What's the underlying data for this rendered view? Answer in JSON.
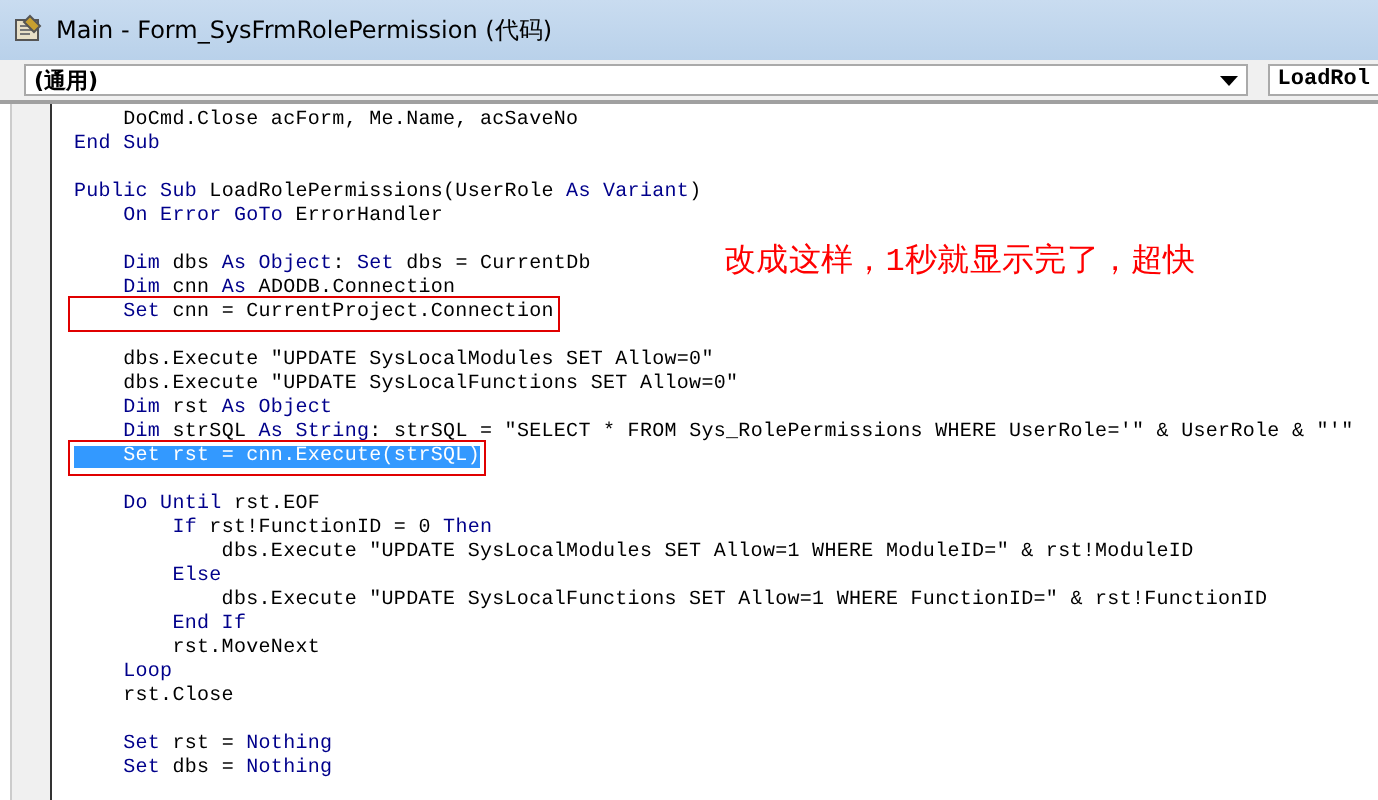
{
  "window": {
    "title": "Main - Form_SysFrmRolePermission (代码)"
  },
  "object_combo": {
    "value": "(通用)"
  },
  "procedure_combo": {
    "value": "LoadRol"
  },
  "code_lines": [
    {
      "kind": "code",
      "tokens": [
        {
          "text": "    DoCmd.Close acForm, Me.Name, acSaveNo",
          "kind": "plain"
        }
      ]
    },
    {
      "kind": "code",
      "tokens": [
        {
          "text": "End Sub",
          "kind": "keyword"
        }
      ]
    },
    {
      "kind": "blank"
    },
    {
      "kind": "code",
      "tokens": [
        {
          "text": "Public Sub",
          "kind": "keyword"
        },
        {
          "text": " LoadRolePermissions(UserRole ",
          "kind": "plain"
        },
        {
          "text": "As Variant",
          "kind": "keyword"
        },
        {
          "text": ")",
          "kind": "plain"
        }
      ]
    },
    {
      "kind": "code",
      "tokens": [
        {
          "text": "    On Error GoTo",
          "kind": "keyword"
        },
        {
          "text": " ErrorHandler",
          "kind": "plain"
        }
      ]
    },
    {
      "kind": "blank"
    },
    {
      "kind": "code",
      "tokens": [
        {
          "text": "    Dim",
          "kind": "keyword"
        },
        {
          "text": " dbs ",
          "kind": "plain"
        },
        {
          "text": "As Object",
          "kind": "keyword"
        },
        {
          "text": ": ",
          "kind": "plain"
        },
        {
          "text": "Set",
          "kind": "keyword"
        },
        {
          "text": " dbs = CurrentDb",
          "kind": "plain"
        }
      ]
    },
    {
      "kind": "code",
      "tokens": [
        {
          "text": "    Dim",
          "kind": "keyword"
        },
        {
          "text": " cnn ",
          "kind": "plain"
        },
        {
          "text": "As",
          "kind": "keyword"
        },
        {
          "text": " ADODB.Connection",
          "kind": "plain"
        }
      ]
    },
    {
      "kind": "code",
      "boxed": true,
      "selected": false,
      "tokens": [
        {
          "text": "    Set",
          "kind": "keyword"
        },
        {
          "text": " cnn = CurrentProject.Connection",
          "kind": "plain"
        }
      ]
    },
    {
      "kind": "blank"
    },
    {
      "kind": "code",
      "tokens": [
        {
          "text": "    dbs.Execute \"UPDATE SysLocalModules SET Allow=0\"",
          "kind": "plain"
        }
      ]
    },
    {
      "kind": "code",
      "tokens": [
        {
          "text": "    dbs.Execute \"UPDATE SysLocalFunctions SET Allow=0\"",
          "kind": "plain"
        }
      ]
    },
    {
      "kind": "code",
      "tokens": [
        {
          "text": "    Dim",
          "kind": "keyword"
        },
        {
          "text": " rst ",
          "kind": "plain"
        },
        {
          "text": "As Object",
          "kind": "keyword"
        }
      ]
    },
    {
      "kind": "code",
      "tokens": [
        {
          "text": "    Dim",
          "kind": "keyword"
        },
        {
          "text": " strSQL ",
          "kind": "plain"
        },
        {
          "text": "As String",
          "kind": "keyword"
        },
        {
          "text": ": strSQL = \"SELECT * FROM Sys_RolePermissions WHERE UserRole='\" & UserRole & \"'\"",
          "kind": "plain"
        }
      ]
    },
    {
      "kind": "code",
      "boxed": true,
      "selected": true,
      "tokens": [
        {
          "text": "    Set",
          "kind": "keyword"
        },
        {
          "text": " rst = cnn.Execute(strSQL)",
          "kind": "plain"
        }
      ]
    },
    {
      "kind": "blank"
    },
    {
      "kind": "code",
      "tokens": [
        {
          "text": "    Do Until",
          "kind": "keyword"
        },
        {
          "text": " rst.EOF",
          "kind": "plain"
        }
      ]
    },
    {
      "kind": "code",
      "tokens": [
        {
          "text": "        If",
          "kind": "keyword"
        },
        {
          "text": " rst!FunctionID = 0 ",
          "kind": "plain"
        },
        {
          "text": "Then",
          "kind": "keyword"
        }
      ]
    },
    {
      "kind": "code",
      "tokens": [
        {
          "text": "            dbs.Execute \"UPDATE SysLocalModules SET Allow=1 WHERE ModuleID=\" & rst!ModuleID",
          "kind": "plain"
        }
      ]
    },
    {
      "kind": "code",
      "tokens": [
        {
          "text": "        Else",
          "kind": "keyword"
        }
      ]
    },
    {
      "kind": "code",
      "tokens": [
        {
          "text": "            dbs.Execute \"UPDATE SysLocalFunctions SET Allow=1 WHERE FunctionID=\" & rst!FunctionID",
          "kind": "plain"
        }
      ]
    },
    {
      "kind": "code",
      "tokens": [
        {
          "text": "        End If",
          "kind": "keyword"
        }
      ]
    },
    {
      "kind": "code",
      "tokens": [
        {
          "text": "        rst.MoveNext",
          "kind": "plain"
        }
      ]
    },
    {
      "kind": "code",
      "tokens": [
        {
          "text": "    Loop",
          "kind": "keyword"
        }
      ]
    },
    {
      "kind": "code",
      "tokens": [
        {
          "text": "    rst.Close",
          "kind": "plain"
        }
      ]
    },
    {
      "kind": "blank"
    },
    {
      "kind": "code",
      "tokens": [
        {
          "text": "    Set",
          "kind": "keyword"
        },
        {
          "text": " rst = ",
          "kind": "plain"
        },
        {
          "text": "Nothing",
          "kind": "keyword"
        }
      ]
    },
    {
      "kind": "code",
      "tokens": [
        {
          "text": "    Set",
          "kind": "keyword"
        },
        {
          "text": " dbs = ",
          "kind": "plain"
        },
        {
          "text": "Nothing",
          "kind": "keyword"
        }
      ]
    }
  ],
  "annotation": "改成这样，1秒就显示完了，超快"
}
